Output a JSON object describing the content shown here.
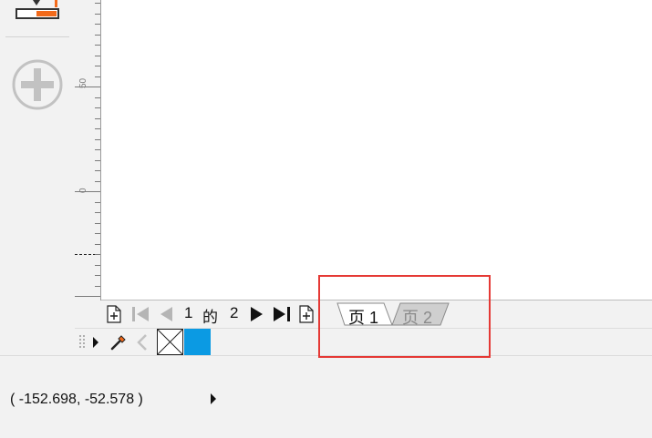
{
  "ruler": {
    "labels": [
      "50",
      "0"
    ]
  },
  "pagebar": {
    "current_page": "1",
    "of_label": "的",
    "total_pages": "2",
    "tabs": [
      {
        "label": "页 1",
        "active": true
      },
      {
        "label": "页 2",
        "active": false
      }
    ]
  },
  "palette": {
    "accent_color": "#0b9ae3",
    "no_color": "none"
  },
  "status": {
    "coordinates": "( -152.698, -52.578 )"
  },
  "colors": {
    "highlight": "#e53935",
    "canvas": "#ffffff",
    "chrome": "#f2f2f2"
  },
  "icons": {
    "toolbox_top": "fill-stroke-icon",
    "add_tool": "plus-circle-icon",
    "add_page_before": "add-page-icon",
    "first_page": "first-page-icon",
    "prev_page": "previous-page-icon",
    "next_page": "next-page-icon",
    "last_page": "last-page-icon",
    "add_page_after": "add-page-icon",
    "eyedropper": "eyedropper-icon"
  }
}
